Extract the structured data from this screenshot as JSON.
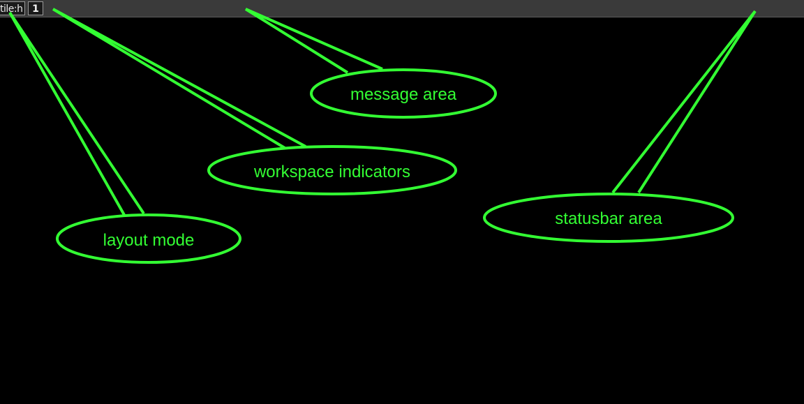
{
  "statusbar": {
    "layout_mode": "tile:h",
    "workspaces": [
      "1"
    ],
    "message": "",
    "status": ""
  },
  "annotations": {
    "color": "#33ff33",
    "message_area": "message area",
    "workspace_indicators": "workspace indicators",
    "statusbar_area": "statusbar area",
    "layout_mode": "layout mode"
  }
}
